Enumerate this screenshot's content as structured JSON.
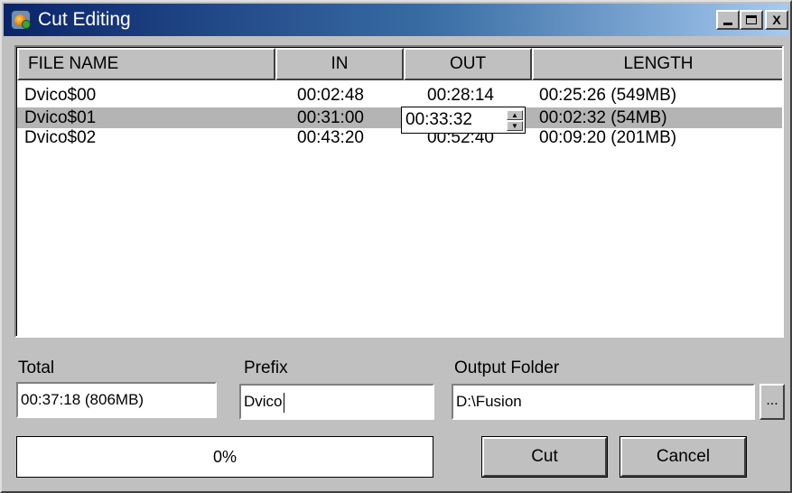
{
  "window": {
    "title": "Cut Editing",
    "app_icon": "dvico-app-icon"
  },
  "controls": {
    "minimize": "_",
    "maximize": "□",
    "close": "X"
  },
  "table": {
    "columns": [
      "FILE NAME",
      "IN",
      "OUT",
      "LENGTH"
    ],
    "rows": [
      {
        "name": "Dvico$00",
        "in": "00:02:48",
        "out": "00:28:14",
        "length": "00:25:26 (549MB)"
      },
      {
        "name": "Dvico$01",
        "in": "00:31:00",
        "out": "00:33:32",
        "length": "00:02:32 (54MB)"
      },
      {
        "name": "Dvico$02",
        "in": "00:43:20",
        "out": "00:52:40",
        "length": "00:09:20 (201MB)"
      }
    ],
    "selected_row": 1,
    "editor": {
      "value": "00:33:32",
      "up": "▲",
      "down": "▼"
    }
  },
  "total": {
    "label": "Total",
    "value": "00:37:18 (806MB)"
  },
  "prefix": {
    "label": "Prefix",
    "value": "Dvico"
  },
  "output": {
    "label": "Output Folder",
    "value": "D:\\Fusion",
    "browse": "..."
  },
  "progress": {
    "text": "0%",
    "value": 0
  },
  "buttons": {
    "cut": "Cut",
    "cancel": "Cancel"
  }
}
